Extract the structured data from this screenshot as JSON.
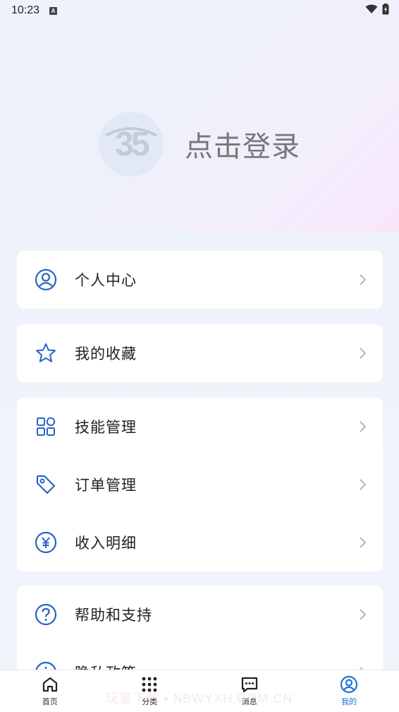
{
  "status_bar": {
    "time": "10:23",
    "notification_glyph": "A"
  },
  "profile": {
    "login_text": "点击登录",
    "avatar_icon": "logo-35-icon"
  },
  "menu_groups": [
    {
      "items": [
        {
          "label": "个人中心",
          "icon": "user-circle-icon"
        }
      ]
    },
    {
      "items": [
        {
          "label": "我的收藏",
          "icon": "star-icon"
        }
      ]
    },
    {
      "items": [
        {
          "label": "技能管理",
          "icon": "grid-apps-icon"
        },
        {
          "label": "订单管理",
          "icon": "tag-icon"
        },
        {
          "label": "收入明细",
          "icon": "yen-circle-icon"
        }
      ]
    },
    {
      "items": [
        {
          "label": "帮助和支持",
          "icon": "question-circle-icon"
        },
        {
          "label": "隐私政策",
          "icon": "info-circle-icon"
        }
      ]
    }
  ],
  "tabbar": {
    "tabs": [
      {
        "label": "首页",
        "icon": "home-icon",
        "active": false
      },
      {
        "label": "分类",
        "icon": "dots-grid-icon",
        "active": false
      },
      {
        "label": "消息",
        "icon": "message-icon",
        "active": false
      },
      {
        "label": "我的",
        "icon": "user-circle-icon",
        "active": true
      }
    ]
  },
  "watermark": "玩意下载 • NBWYXH.COM.CN",
  "colors": {
    "accent": "#1a74d2",
    "icon_blue": "#2b63c4"
  }
}
